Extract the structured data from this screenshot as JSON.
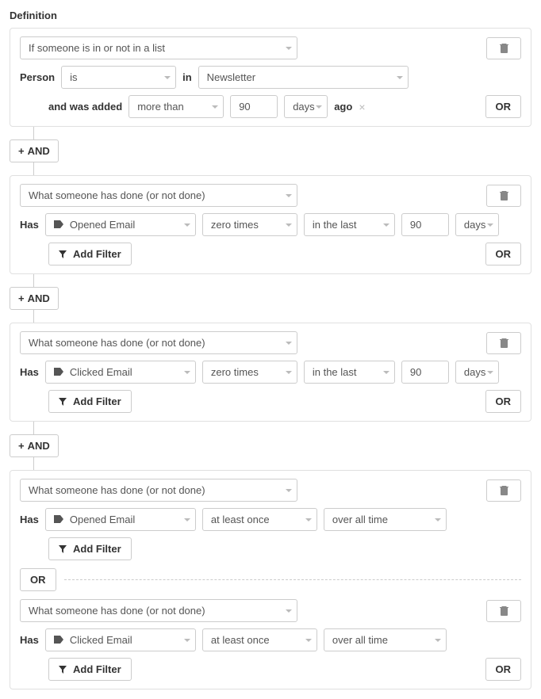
{
  "title": "Definition",
  "labels": {
    "person": "Person",
    "in": "in",
    "and_was_added": "and was added",
    "ago": "ago",
    "has": "Has",
    "and": "AND",
    "or": "OR",
    "add_filter": "Add Filter"
  },
  "groups": [
    {
      "condition_type": "If someone is in or not in a list",
      "person_op": "is",
      "list_name": "Newsletter",
      "added_op": "more than",
      "added_value": "90",
      "added_unit": "days"
    },
    {
      "condition_type": "What someone has done (or not done)",
      "metric": "Opened Email",
      "freq": "zero times",
      "range": "in the last",
      "value": "90",
      "unit": "days"
    },
    {
      "condition_type": "What someone has done (or not done)",
      "metric": "Clicked Email",
      "freq": "zero times",
      "range": "in the last",
      "value": "90",
      "unit": "days"
    },
    {
      "conditions": [
        {
          "condition_type": "What someone has done (or not done)",
          "metric": "Opened Email",
          "freq": "at least once",
          "range": "over all time"
        },
        {
          "condition_type": "What someone has done (or not done)",
          "metric": "Clicked Email",
          "freq": "at least once",
          "range": "over all time"
        }
      ]
    }
  ]
}
